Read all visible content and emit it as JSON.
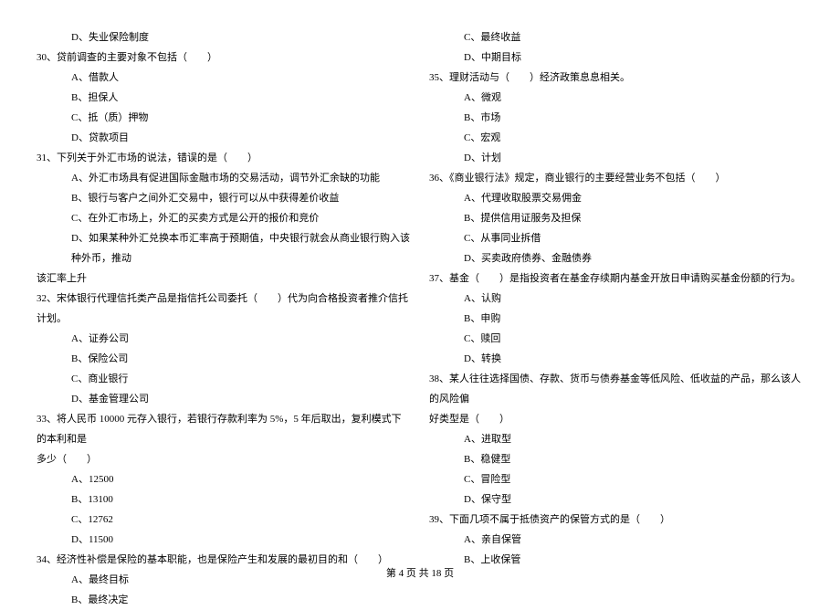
{
  "leftColumn": {
    "q29_optD": "D、失业保险制度",
    "q30_text": "30、贷前调查的主要对象不包括（　　）",
    "q30_optA": "A、借款人",
    "q30_optB": "B、担保人",
    "q30_optC": "C、抵（质）押物",
    "q30_optD": "D、贷款项目",
    "q31_text": "31、下列关于外汇市场的说法，错误的是（　　）",
    "q31_optA": "A、外汇市场具有促进国际金融市场的交易活动，调节外汇余缺的功能",
    "q31_optB": "B、银行与客户之间外汇交易中，银行可以从中获得差价收益",
    "q31_optC": "C、在外汇市场上，外汇的买卖方式是公开的报价和竞价",
    "q31_optD": "D、如果某种外汇兑换本币汇率高于预期值，中央银行就会从商业银行购入该种外币，推动",
    "q31_cont": "该汇率上升",
    "q32_text": "32、宋体银行代理信托类产品是指信托公司委托（　　）代为向合格投资者推介信托计划。",
    "q32_optA": "A、证券公司",
    "q32_optB": "B、保险公司",
    "q32_optC": "C、商业银行",
    "q32_optD": "D、基金管理公司",
    "q33_text": "33、将人民币 10000 元存入银行，若银行存款利率为 5%，5 年后取出，复利模式下的本利和是",
    "q33_cont": "多少（　　）",
    "q33_optA": "A、12500",
    "q33_optB": "B、13100",
    "q33_optC": "C、12762",
    "q33_optD": "D、11500",
    "q34_text": "34、经济性补偿是保险的基本职能，也是保险产生和发展的最初目的和（　　）",
    "q34_optA": "A、最终目标",
    "q34_optB": "B、最终决定"
  },
  "rightColumn": {
    "q34_optC": "C、最终收益",
    "q34_optD": "D、中期目标",
    "q35_text": "35、理财活动与（　　）经济政策息息相关。",
    "q35_optA": "A、微观",
    "q35_optB": "B、市场",
    "q35_optC": "C、宏观",
    "q35_optD": "D、计划",
    "q36_text": "36、《商业银行法》规定，商业银行的主要经营业务不包括（　　）",
    "q36_optA": "A、代理收取股票交易佣金",
    "q36_optB": "B、提供信用证服务及担保",
    "q36_optC": "C、从事同业拆借",
    "q36_optD": "D、买卖政府债券、金融债券",
    "q37_text": "37、基金（　　）是指投资者在基金存续期内基金开放日申请购买基金份额的行为。",
    "q37_optA": "A、认购",
    "q37_optB": "B、申购",
    "q37_optC": "C、赎回",
    "q37_optD": "D、转换",
    "q38_text": "38、某人往往选择国债、存款、货币与债券基金等低风险、低收益的产品，那么该人的风险偏",
    "q38_cont": "好类型是（　　）",
    "q38_optA": "A、进取型",
    "q38_optB": "B、稳健型",
    "q38_optC": "C、冒险型",
    "q38_optD": "D、保守型",
    "q39_text": "39、下面几项不属于抵债资产的保管方式的是（　　）",
    "q39_optA": "A、亲自保管",
    "q39_optB": "B、上收保管"
  },
  "footer": "第 4 页 共 18 页"
}
